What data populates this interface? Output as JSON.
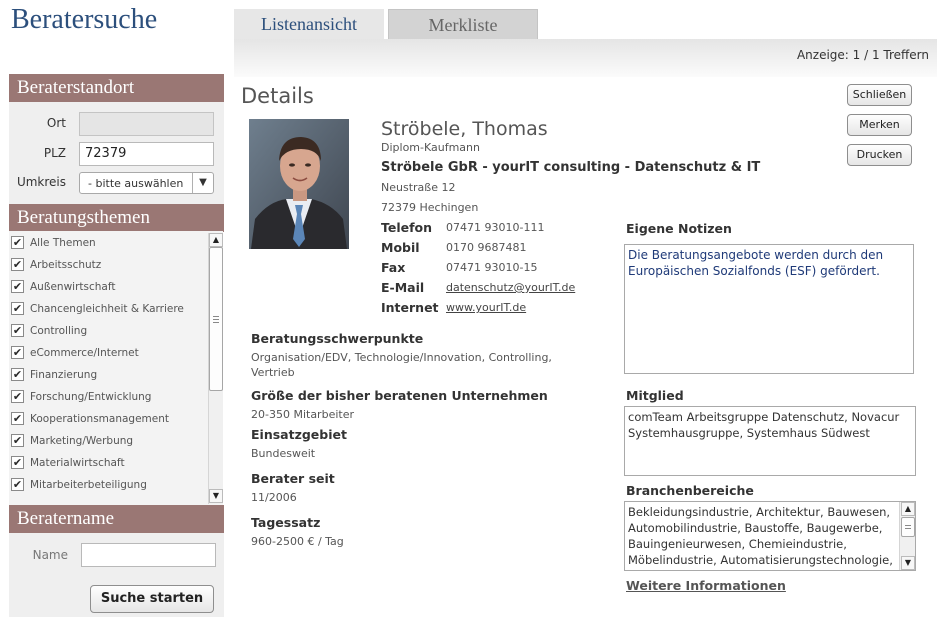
{
  "app_title": "Beratersuche",
  "location_panel": {
    "header": "Beraterstandort",
    "ort_label": "Ort",
    "ort_value": "",
    "plz_label": "PLZ",
    "plz_value": "72379",
    "umkreis_label": "Umkreis",
    "umkreis_value": "- bitte auswählen",
    "umkreis_arrow": "▼"
  },
  "topics_panel": {
    "header": "Beratungsthemen",
    "items": [
      {
        "label": "Alle Themen",
        "checked": true
      },
      {
        "label": "Arbeitsschutz",
        "checked": true
      },
      {
        "label": "Außenwirtschaft",
        "checked": true
      },
      {
        "label": "Chancengleichheit & Karriere",
        "checked": true
      },
      {
        "label": "Controlling",
        "checked": true
      },
      {
        "label": "eCommerce/Internet",
        "checked": true
      },
      {
        "label": "Finanzierung",
        "checked": true
      },
      {
        "label": "Forschung/Entwicklung",
        "checked": true
      },
      {
        "label": "Kooperationsmanagement",
        "checked": true
      },
      {
        "label": "Marketing/Werbung",
        "checked": true
      },
      {
        "label": "Materialwirtschaft",
        "checked": true
      },
      {
        "label": "Mitarbeiterbeteiligung",
        "checked": true
      }
    ],
    "scroll_up": "▲",
    "scroll_down": "▼"
  },
  "name_panel": {
    "header": "Beratername",
    "name_label": "Name",
    "name_value": "",
    "search_button": "Suche starten"
  },
  "tabs": [
    {
      "label": "Listenansicht",
      "active": true
    },
    {
      "label": "Merkliste",
      "active": false
    }
  ],
  "hits_text": "Anzeige: 1 / 1 Treffern",
  "details": {
    "title": "Details",
    "buttons": {
      "close": "Schließen",
      "remember": "Merken",
      "print": "Drucken"
    },
    "name": "Ströbele, Thomas",
    "profession": "Diplom-Kaufmann",
    "company": "Ströbele GbR - yourIT consulting - Datenschutz & IT",
    "street": "Neustraße 12",
    "city": "72379 Hechingen",
    "contacts": [
      {
        "label": "Telefon",
        "value": "07471 93010-111",
        "link": false
      },
      {
        "label": "Mobil",
        "value": "0170 9687481",
        "link": false
      },
      {
        "label": "Fax",
        "value": "07471 93010-15",
        "link": false
      },
      {
        "label": "E-Mail",
        "value": "datenschutz@yourIT.de",
        "link": true
      },
      {
        "label": "Internet",
        "value": "www.yourIT.de",
        "link": true
      }
    ],
    "focus_label": "Beratungsschwerpunkte",
    "focus_value_line1": "Organisation/EDV, Technologie/Innovation, Controlling,",
    "focus_value_line2": "Vertrieb",
    "size_label": "Größe der bisher beratenen Unternehmen",
    "size_value": "20-350 Mitarbeiter",
    "area_label": "Einsatzgebiet",
    "area_value": "Bundesweit",
    "since_label": "Berater seit",
    "since_value": "11/2006",
    "rate_label": "Tagessatz",
    "rate_value": "960-2500 € / Tag",
    "notes_label": "Eigene Notizen",
    "notes_value": "Die Beratungsangebote werden durch den Europäischen Sozialfonds (ESF) gefördert.",
    "member_label": "Mitglied",
    "member_value": "comTeam Arbeitsgruppe Datenschutz, Novacur Systemhausgruppe, Systemhaus Südwest",
    "branch_label": "Branchenbereiche",
    "branch_value": "Bekleidungsindustrie, Architektur, Bauwesen, Automobilindustrie, Baustoffe, Baugewerbe, Bauingenieurwesen, Chemieindustrie, Möbelindustrie, Automatisierungstechnologie,",
    "more_info": "Weitere Informationen"
  },
  "colors": {
    "panel_header": "#9a7774",
    "title_blue": "#2c4f7c",
    "notes_text": "#1f3a78"
  }
}
